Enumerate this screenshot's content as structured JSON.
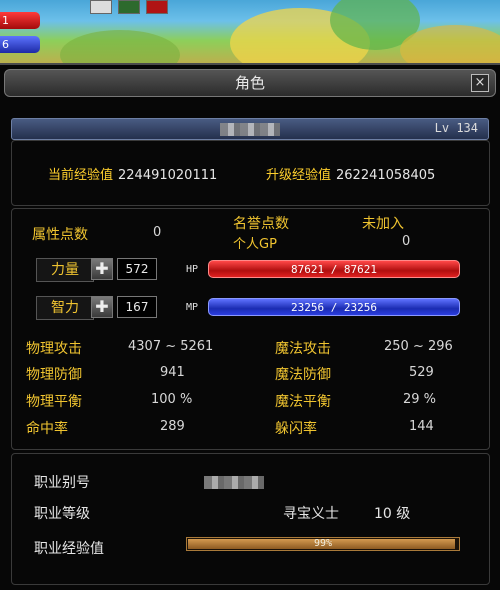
{
  "hud": {
    "hp_digit": "1",
    "mp_digit": "6"
  },
  "window": {
    "title": "角色",
    "close_label": "×"
  },
  "character": {
    "level": "Lv 134"
  },
  "exp": {
    "current_label": "当前经验值",
    "current_value": "224491020111",
    "next_label": "升级经验值",
    "next_value": "262241058405"
  },
  "points": {
    "attr_label": "属性点数",
    "attr_value": "0",
    "honor_label": "名誉点数",
    "honor_value": "未加入",
    "gp_label": "个人GP",
    "gp_value": "0"
  },
  "stats": {
    "str_label": "力量",
    "str_value": "572",
    "int_label": "智力",
    "int_value": "167",
    "hp_tag": "HP",
    "hp_text": "87621 / 87621",
    "hp_current": 87621,
    "hp_max": 87621,
    "mp_tag": "MP",
    "mp_text": "23256 / 23256",
    "mp_current": 23256,
    "mp_max": 23256
  },
  "combat": {
    "phys_atk_label": "物理攻击",
    "phys_atk_value": "4307 ~ 5261",
    "mag_atk_label": "魔法攻击",
    "mag_atk_value": "250 ~ 296",
    "phys_def_label": "物理防御",
    "phys_def_value": "941",
    "mag_def_label": "魔法防御",
    "mag_def_value": "529",
    "phys_bal_label": "物理平衡",
    "phys_bal_value": "100 %",
    "mag_bal_label": "魔法平衡",
    "mag_bal_value": "29 %",
    "hit_label": "命中率",
    "hit_value": "289",
    "dodge_label": "躲闪率",
    "dodge_value": "144"
  },
  "job": {
    "alias_label": "职业别号",
    "level_label": "职业等级",
    "job_name": "寻宝义士",
    "job_level": "10 级",
    "exp_label": "职业经验值",
    "exp_text": "99%",
    "exp_fraction": 0.99
  },
  "colors": {
    "label_gold": "#f0c430",
    "exp_gold": "#ffd02e",
    "hp_red": "#d81818",
    "mp_blue": "#2233c8"
  }
}
